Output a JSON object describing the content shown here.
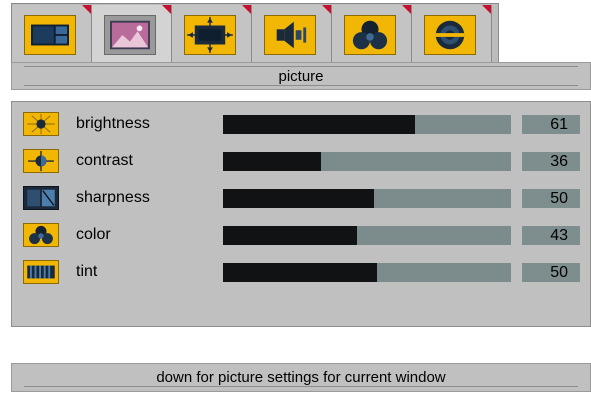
{
  "tabs": [
    {
      "icon": "layout-icon"
    },
    {
      "icon": "picture-icon"
    },
    {
      "icon": "screen-position-icon"
    },
    {
      "icon": "audio-icon"
    },
    {
      "icon": "color-icon"
    },
    {
      "icon": "setup-icon"
    }
  ],
  "page": {
    "title": "picture"
  },
  "settings": [
    {
      "label": "brightness",
      "value": "61",
      "icon": "brightness-icon"
    },
    {
      "label": "contrast",
      "value": "36",
      "icon": "contrast-icon"
    },
    {
      "label": "sharpness",
      "value": "50",
      "icon": "sharpness-icon"
    },
    {
      "label": "color",
      "value": "43",
      "icon": "color-icon"
    },
    {
      "label": "tint",
      "value": "50",
      "icon": "tint-icon"
    }
  ],
  "help": {
    "text": "down for picture settings for current window"
  },
  "colors": {
    "accent": "#f2b705",
    "tab_marker": "#c8102e",
    "bar_fill": "#101214",
    "bar_track": "#7c8c8c",
    "panel": "#c0c0c0"
  }
}
